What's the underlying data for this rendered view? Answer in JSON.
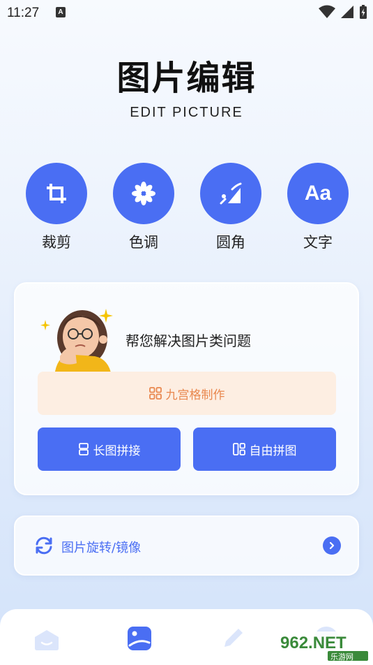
{
  "status": {
    "time": "11:27",
    "a_badge": "A"
  },
  "header": {
    "title": "图片编辑",
    "subtitle": "EDIT PICTURE"
  },
  "tools": [
    {
      "label": "裁剪",
      "icon": "crop-icon"
    },
    {
      "label": "色调",
      "icon": "flower-tone-icon"
    },
    {
      "label": "圆角",
      "icon": "round-corner-icon"
    },
    {
      "label": "文字",
      "icon": "text-aa-icon",
      "glyph": "Aa"
    }
  ],
  "card": {
    "title": "帮您解决图片类问题",
    "grid_button": "九宫格制作",
    "long_button": "长图拼接",
    "free_button": "自由拼图"
  },
  "rotate": {
    "label": "图片旋转/镜像"
  },
  "tabbar": {
    "tabs": [
      "home-icon",
      "picture-icon",
      "edit-pen-icon",
      "profile-icon"
    ]
  },
  "watermark": {
    "brand": "962.NET",
    "sub": "乐游网"
  },
  "colors": {
    "accent": "#4a6ef3",
    "orange": "#e9884f",
    "orange_bg": "#fdeee2"
  }
}
